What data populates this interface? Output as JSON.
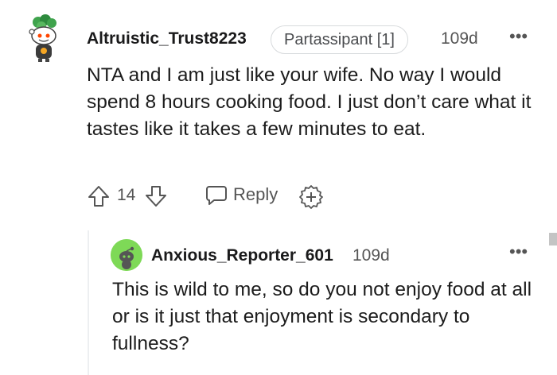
{
  "comment": {
    "username": "Altruistic_Trust8223",
    "flair": "Partassipant [1]",
    "time": "109d",
    "more_icon": "•••",
    "body": "NTA and I am just like your wife. No way I would spend 8 hours cooking food. I just don’t care what it tastes like it takes a few minutes to eat.",
    "score": "14",
    "reply_label": "Reply"
  },
  "reply": {
    "username": "Anxious_Reporter_601",
    "time": "109d",
    "more_icon": "•••",
    "body": "This is wild to me, so do you not enjoy food at all or is it just that enjoyment is secondary to fullness?"
  },
  "colors": {
    "avatar_green": "#7ed957",
    "text": "#1a1a1b",
    "meta": "#555555"
  },
  "icons": [
    "upvote-icon",
    "downvote-icon",
    "comment-bubble-icon",
    "award-icon",
    "more-options-icon"
  ]
}
